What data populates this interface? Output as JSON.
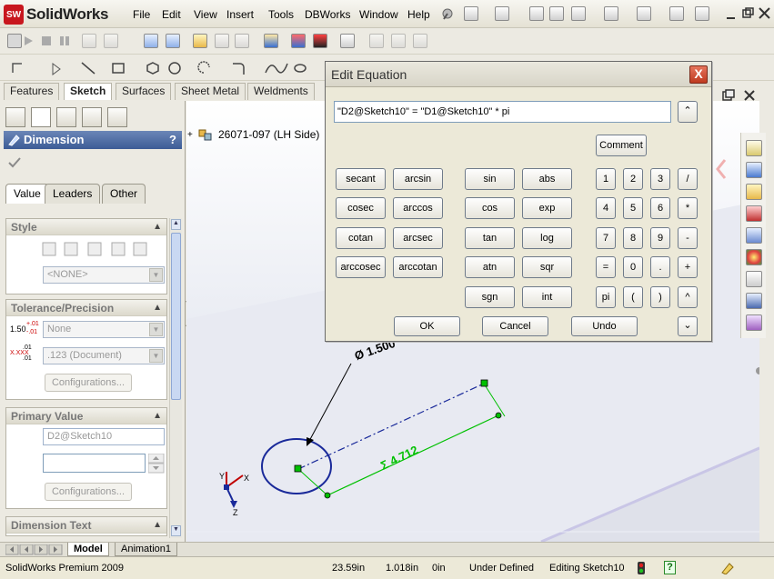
{
  "app": {
    "logo_text": "SW",
    "name": "SolidWorks"
  },
  "menu": [
    "File",
    "Edit",
    "View",
    "Insert",
    "Tools",
    "DBWorks",
    "Window",
    "Help"
  ],
  "command_tabs": [
    "Features",
    "Sketch",
    "Surfaces",
    "Sheet Metal",
    "Weldments"
  ],
  "property_manager": {
    "title": "Dimension",
    "help": "?",
    "tabs": [
      "Value",
      "Leaders",
      "Other"
    ],
    "style": {
      "label": "Style",
      "combo_value": "<NONE>"
    },
    "tolerance": {
      "label": "Tolerance/Precision",
      "tol_combo": "None",
      "precision_combo": ".123 (Document)",
      "configurations_button": "Configurations...",
      "icon1_main": "1.50",
      "icon1_sup": "+.01",
      "icon1_sub": "-.01",
      "icon2_main": "X.XXX",
      "icon2_sup": ".01",
      "icon2_sub": ".01"
    },
    "primary_value": {
      "label": "Primary Value",
      "name_field": "D2@Sketch10",
      "value_field": "",
      "configurations_button": "Configurations..."
    },
    "dimension_text": {
      "label": "Dimension Text"
    }
  },
  "tree": {
    "node_label": "26071-097  (LH Side)"
  },
  "sketch": {
    "diameter_label": "Ø 1.500",
    "length_label": "Σ 4.712"
  },
  "dialog": {
    "title": "Edit Equation",
    "close": "X",
    "equation": "\"D2@Sketch10\" = \"D1@Sketch10\" *  pi",
    "comment": "Comment",
    "func_col1": [
      "secant",
      "cosec",
      "cotan",
      "arccosec"
    ],
    "func_col2": [
      "arcsin",
      "arccos",
      "arcsec",
      "arccotan"
    ],
    "func_col3": [
      "sin",
      "cos",
      "tan",
      "atn",
      "sgn"
    ],
    "func_col4": [
      "abs",
      "exp",
      "log",
      "sqr",
      "int"
    ],
    "keypad": [
      [
        "1",
        "2",
        "3",
        "/"
      ],
      [
        "4",
        "5",
        "6",
        "*"
      ],
      [
        "7",
        "8",
        "9",
        "-"
      ],
      [
        "=",
        "0",
        ".",
        "+"
      ],
      [
        "pi",
        "(",
        ")",
        "^"
      ]
    ],
    "ok": "OK",
    "cancel": "Cancel",
    "undo": "Undo"
  },
  "model_tabs": [
    "Model",
    "Animation1"
  ],
  "status": {
    "product": "SolidWorks Premium 2009",
    "x": "23.59in",
    "y": "1.018in",
    "z": "0in",
    "state": "Under Defined",
    "editing": "Editing Sketch10",
    "help": "?"
  },
  "colors": {
    "sketch_blue": "#1a2a9a",
    "sketch_green": "#00c000",
    "dialog_bg": "#ece9d8",
    "header_blue": "#3c5c96"
  }
}
